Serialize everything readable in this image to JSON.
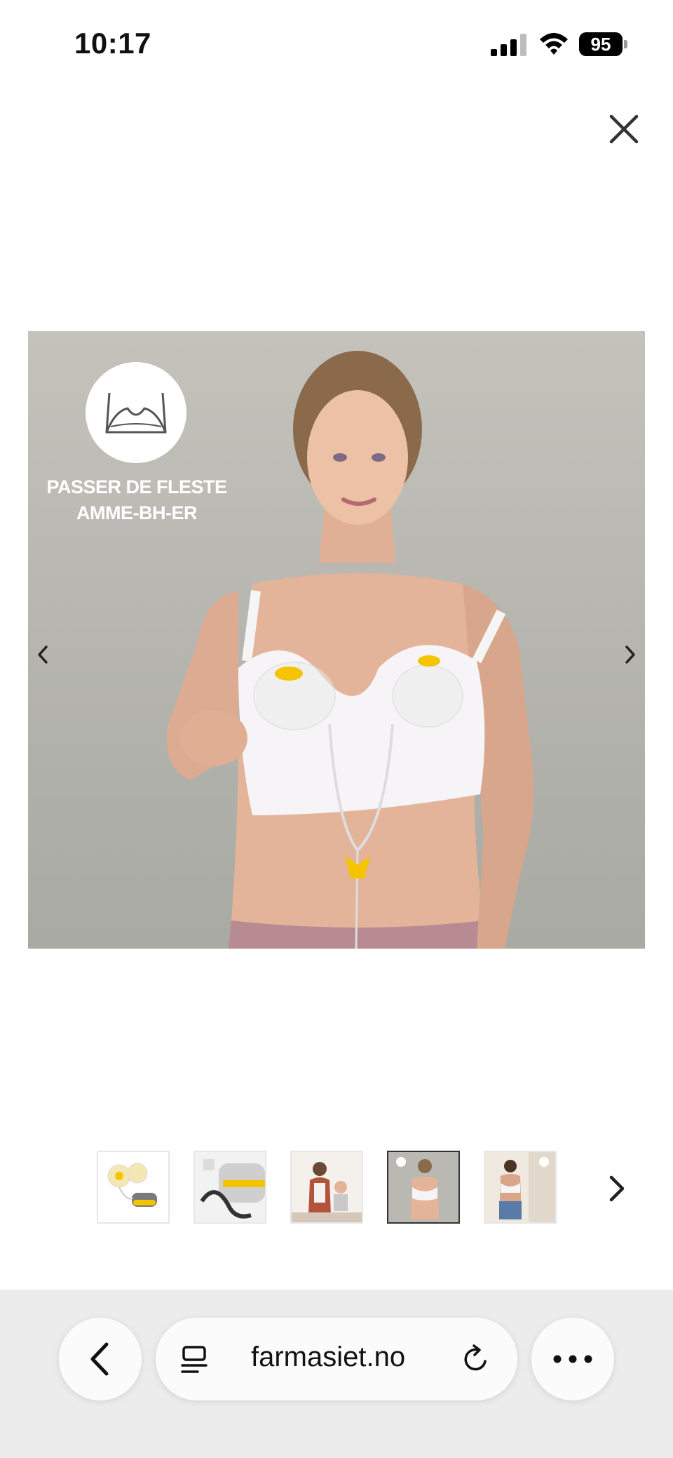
{
  "status_bar": {
    "time": "10:17",
    "battery": "95"
  },
  "gallery": {
    "badge_text_line1": "PASSER DE FLESTE",
    "badge_text_line2": "AMME-BH-ER",
    "icons": {
      "close": "close-icon",
      "prev": "chevron-left-icon",
      "next": "chevron-right-icon",
      "badge": "bra-icon"
    }
  },
  "thumbnails": [
    {
      "name": "pump-product",
      "active": false
    },
    {
      "name": "pump-unit-closeup",
      "active": false
    },
    {
      "name": "mother-with-baby",
      "active": false
    },
    {
      "name": "bra-fit",
      "active": true
    },
    {
      "name": "woman-kitchen",
      "active": false
    }
  ],
  "browser": {
    "url": "farmasiet.no",
    "icons": {
      "back": "chevron-left-icon",
      "reader": "reader-icon",
      "reload": "reload-icon",
      "more": "more-icon"
    }
  },
  "colors": {
    "accent_yellow": "#f5c400",
    "image_background": "#b8b7b1",
    "browser_bar": "#ececec"
  }
}
